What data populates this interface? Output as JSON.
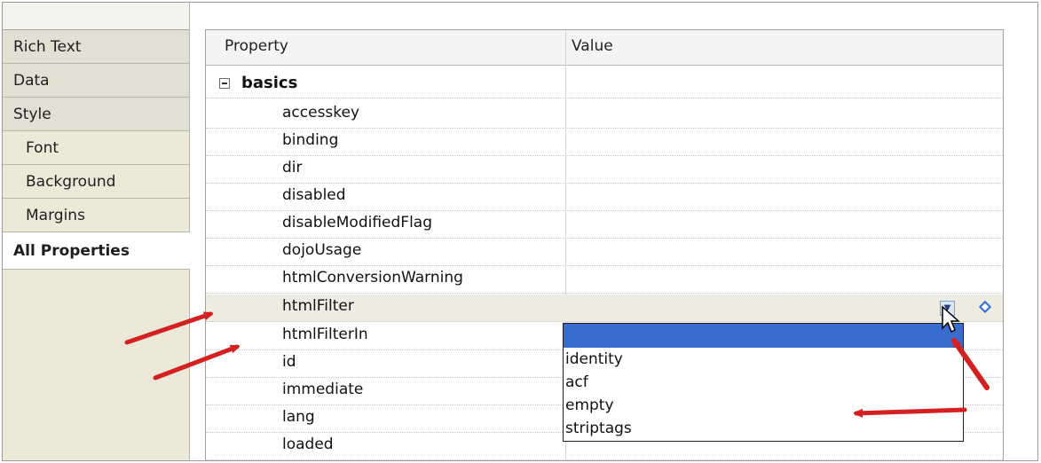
{
  "nav": {
    "items": [
      {
        "label": "Rich Text"
      },
      {
        "label": "Data"
      },
      {
        "label": "Style"
      },
      {
        "label": "Font"
      },
      {
        "label": "Background"
      },
      {
        "label": "Margins"
      },
      {
        "label": "All Properties"
      }
    ]
  },
  "sheet": {
    "col_property": "Property",
    "col_value": "Value",
    "category": "basics",
    "rows": [
      "accesskey",
      "binding",
      "dir",
      "disabled",
      "disableModifiedFlag",
      "dojoUsage",
      "htmlConversionWarning",
      "htmlFilter",
      "htmlFilterIn",
      "id",
      "immediate",
      "lang",
      "loaded"
    ]
  },
  "dropdown": {
    "selected_value": "",
    "options": [
      "identity",
      "acf",
      "empty",
      "striptags"
    ]
  },
  "icons": {
    "collapse": "collapse-minus-icon",
    "dropdown": "chevron-down-icon",
    "diamond": "diamond-icon",
    "cursor": "mouse-pointer-icon",
    "arrow": "red-arrow-icon"
  },
  "colors": {
    "selection": "#3a6ccf",
    "arrow": "#d42020",
    "nav_bg": "#ece9d8"
  }
}
